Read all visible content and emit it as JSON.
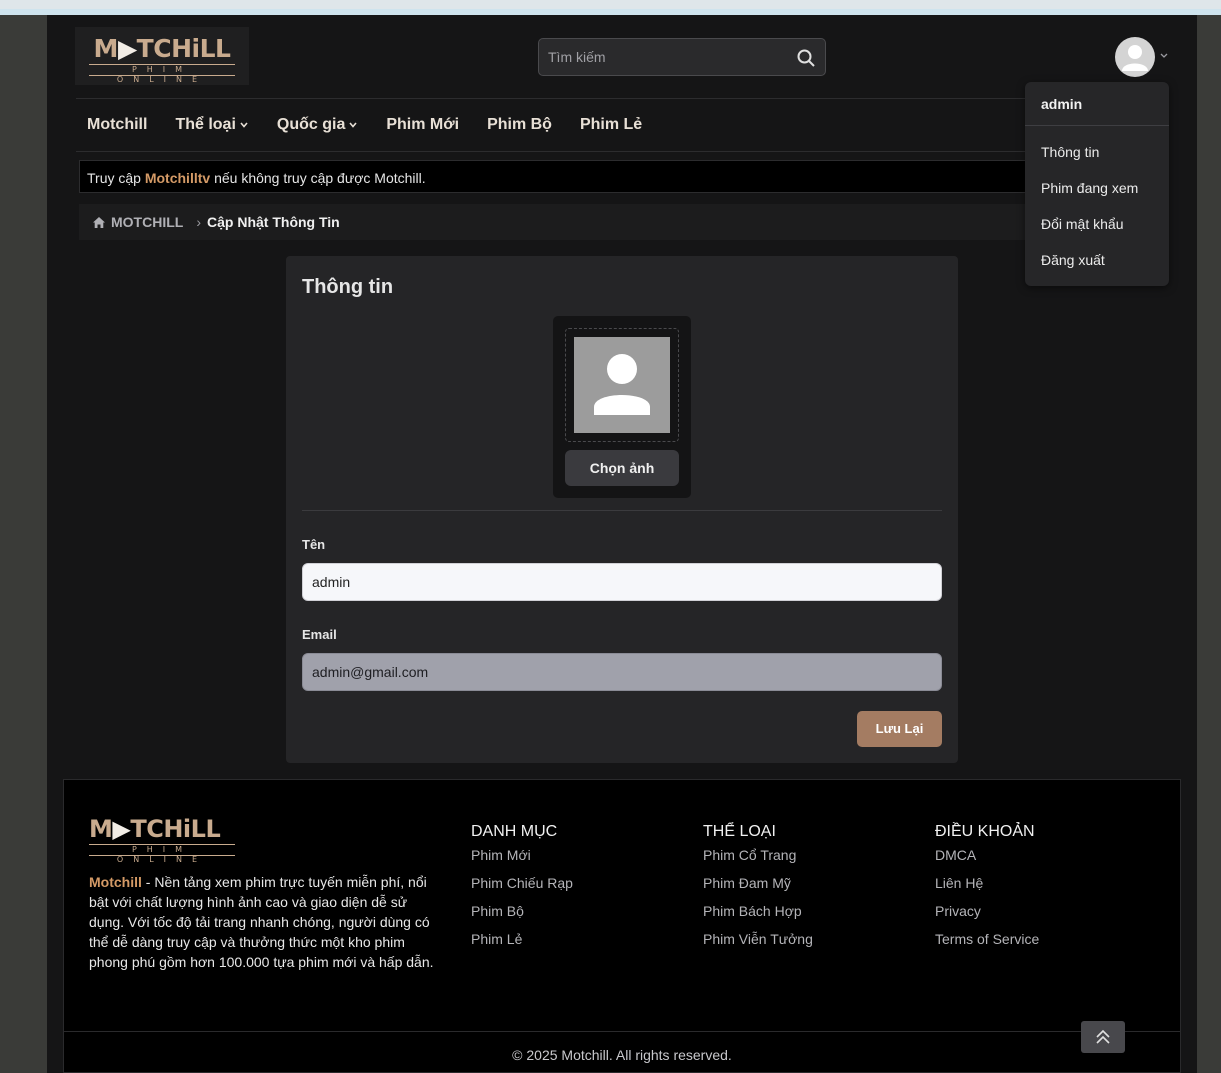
{
  "header": {
    "logo": {
      "text_part1": "M",
      "text_part2": "TCHiLL",
      "subtitle": "PHIM ONLINE"
    },
    "search_placeholder": "Tìm kiếm"
  },
  "nav": {
    "items": [
      {
        "label": "Motchill"
      },
      {
        "label": "Thể loại"
      },
      {
        "label": "Quốc gia"
      },
      {
        "label": "Phim Mới"
      },
      {
        "label": "Phim Bộ"
      },
      {
        "label": "Phim Lẻ"
      }
    ]
  },
  "notice": {
    "prefix": "Truy cập ",
    "link": "Motchilltv",
    "suffix": " nếu không truy cập được Motchill."
  },
  "breadcrumb": {
    "home": "MOTCHILL",
    "current": "Cập Nhật Thông Tin"
  },
  "user_menu": {
    "username": "admin",
    "items": [
      "Thông tin",
      "Phim đang xem",
      "Đổi mật khẩu",
      "Đăng xuất"
    ]
  },
  "profile": {
    "title": "Thông tin",
    "choose_image": "Chọn ảnh",
    "name_label": "Tên",
    "name_value": "admin",
    "email_label": "Email",
    "email_value": "admin@gmail.com",
    "save": "Lưu Lại"
  },
  "footer": {
    "brand": "Motchill",
    "description": " - Nền tảng xem phim trực tuyến miễn phí, nổi bật với chất lượng hình ảnh cao và giao diện dễ sử dụng. Với tốc độ tải trang nhanh chóng, người dùng có thể dễ dàng truy cập và thưởng thức một kho phim phong phú gồm hơn 100.000 tựa phim mới và hấp dẫn.",
    "columns": [
      {
        "title": "DANH MỤC",
        "links": [
          "Phim Mới",
          "Phim Chiếu Rạp",
          "Phim Bộ",
          "Phim Lẻ"
        ]
      },
      {
        "title": "THỂ LOẠI",
        "links": [
          "Phim Cổ Trang",
          "Phim Đam Mỹ",
          "Phim Bách Hợp",
          "Phim Viễn Tưởng"
        ]
      },
      {
        "title": "ĐIỀU KHOẢN",
        "links": [
          "DMCA",
          "Liên Hệ",
          "Privacy",
          "Terms of Service"
        ]
      }
    ],
    "copyright": "© 2025 Motchill. All rights reserved."
  },
  "colors": {
    "accent": "#d49a66",
    "save_button": "#a47c62",
    "logo": "#c9ab8e"
  }
}
